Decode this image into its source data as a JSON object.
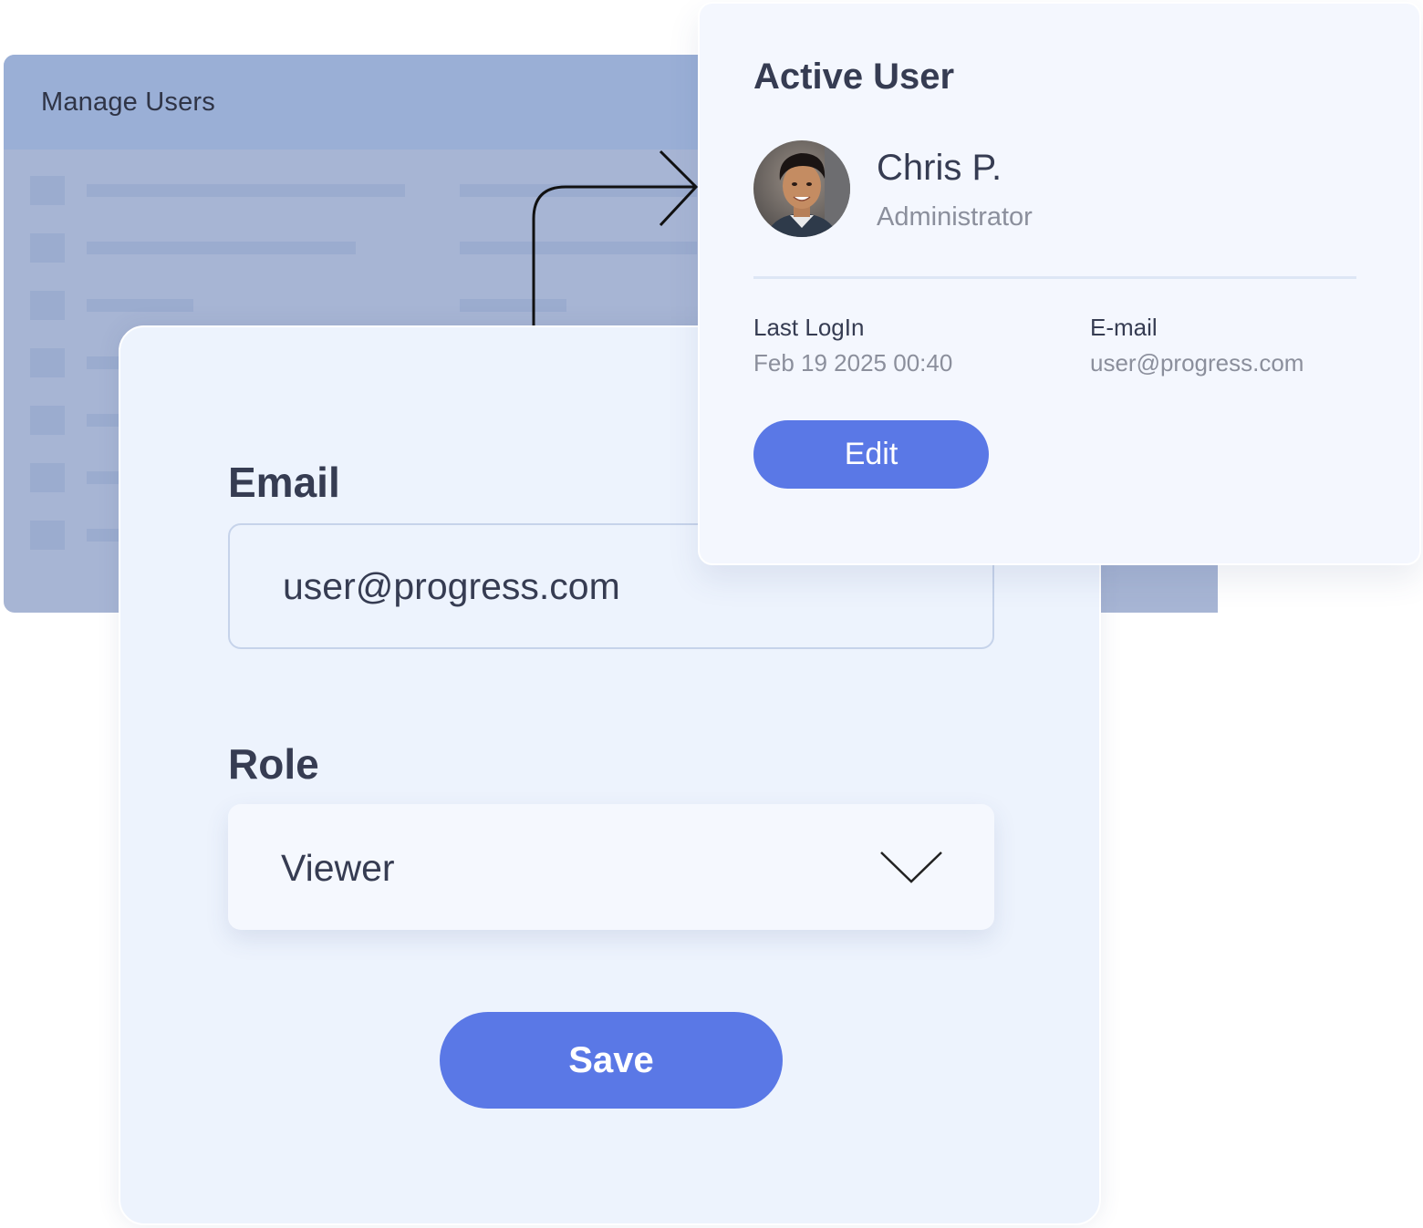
{
  "manage_users": {
    "title": "Manage Users"
  },
  "edit_form": {
    "email_label": "Email",
    "email_value": "user@progress.com",
    "role_label": "Role",
    "role_value": "Viewer",
    "save_label": "Save"
  },
  "active_user": {
    "title": "Active User",
    "name": "Chris P.",
    "role": "Administrator",
    "last_login_label": "Last LogIn",
    "last_login_value": "Feb 19 2025 00:40",
    "email_label": "E-mail",
    "email_value": "user@progress.com",
    "edit_label": "Edit"
  },
  "colors": {
    "accent": "#5a78e6",
    "panel_bg": "#a7b5d4",
    "panel_header": "#9aafd6",
    "card_bg": "#f4f7fe",
    "form_bg": "#edf3fd",
    "text_primary": "#363c52",
    "text_secondary": "#8b8f9c"
  },
  "icons": {
    "dropdown": "chevron-down-icon",
    "connector": "arrow-connector-icon",
    "avatar": "user-avatar"
  }
}
